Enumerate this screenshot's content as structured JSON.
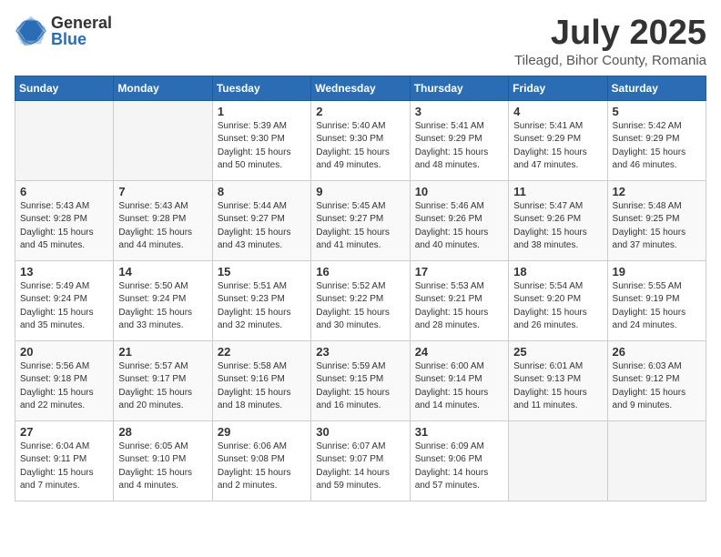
{
  "logo": {
    "general": "General",
    "blue": "Blue"
  },
  "title": "July 2025",
  "subtitle": "Tileagd, Bihor County, Romania",
  "days_header": [
    "Sunday",
    "Monday",
    "Tuesday",
    "Wednesday",
    "Thursday",
    "Friday",
    "Saturday"
  ],
  "weeks": [
    [
      {
        "num": "",
        "info": ""
      },
      {
        "num": "",
        "info": ""
      },
      {
        "num": "1",
        "info": "Sunrise: 5:39 AM\nSunset: 9:30 PM\nDaylight: 15 hours\nand 50 minutes."
      },
      {
        "num": "2",
        "info": "Sunrise: 5:40 AM\nSunset: 9:30 PM\nDaylight: 15 hours\nand 49 minutes."
      },
      {
        "num": "3",
        "info": "Sunrise: 5:41 AM\nSunset: 9:29 PM\nDaylight: 15 hours\nand 48 minutes."
      },
      {
        "num": "4",
        "info": "Sunrise: 5:41 AM\nSunset: 9:29 PM\nDaylight: 15 hours\nand 47 minutes."
      },
      {
        "num": "5",
        "info": "Sunrise: 5:42 AM\nSunset: 9:29 PM\nDaylight: 15 hours\nand 46 minutes."
      }
    ],
    [
      {
        "num": "6",
        "info": "Sunrise: 5:43 AM\nSunset: 9:28 PM\nDaylight: 15 hours\nand 45 minutes."
      },
      {
        "num": "7",
        "info": "Sunrise: 5:43 AM\nSunset: 9:28 PM\nDaylight: 15 hours\nand 44 minutes."
      },
      {
        "num": "8",
        "info": "Sunrise: 5:44 AM\nSunset: 9:27 PM\nDaylight: 15 hours\nand 43 minutes."
      },
      {
        "num": "9",
        "info": "Sunrise: 5:45 AM\nSunset: 9:27 PM\nDaylight: 15 hours\nand 41 minutes."
      },
      {
        "num": "10",
        "info": "Sunrise: 5:46 AM\nSunset: 9:26 PM\nDaylight: 15 hours\nand 40 minutes."
      },
      {
        "num": "11",
        "info": "Sunrise: 5:47 AM\nSunset: 9:26 PM\nDaylight: 15 hours\nand 38 minutes."
      },
      {
        "num": "12",
        "info": "Sunrise: 5:48 AM\nSunset: 9:25 PM\nDaylight: 15 hours\nand 37 minutes."
      }
    ],
    [
      {
        "num": "13",
        "info": "Sunrise: 5:49 AM\nSunset: 9:24 PM\nDaylight: 15 hours\nand 35 minutes."
      },
      {
        "num": "14",
        "info": "Sunrise: 5:50 AM\nSunset: 9:24 PM\nDaylight: 15 hours\nand 33 minutes."
      },
      {
        "num": "15",
        "info": "Sunrise: 5:51 AM\nSunset: 9:23 PM\nDaylight: 15 hours\nand 32 minutes."
      },
      {
        "num": "16",
        "info": "Sunrise: 5:52 AM\nSunset: 9:22 PM\nDaylight: 15 hours\nand 30 minutes."
      },
      {
        "num": "17",
        "info": "Sunrise: 5:53 AM\nSunset: 9:21 PM\nDaylight: 15 hours\nand 28 minutes."
      },
      {
        "num": "18",
        "info": "Sunrise: 5:54 AM\nSunset: 9:20 PM\nDaylight: 15 hours\nand 26 minutes."
      },
      {
        "num": "19",
        "info": "Sunrise: 5:55 AM\nSunset: 9:19 PM\nDaylight: 15 hours\nand 24 minutes."
      }
    ],
    [
      {
        "num": "20",
        "info": "Sunrise: 5:56 AM\nSunset: 9:18 PM\nDaylight: 15 hours\nand 22 minutes."
      },
      {
        "num": "21",
        "info": "Sunrise: 5:57 AM\nSunset: 9:17 PM\nDaylight: 15 hours\nand 20 minutes."
      },
      {
        "num": "22",
        "info": "Sunrise: 5:58 AM\nSunset: 9:16 PM\nDaylight: 15 hours\nand 18 minutes."
      },
      {
        "num": "23",
        "info": "Sunrise: 5:59 AM\nSunset: 9:15 PM\nDaylight: 15 hours\nand 16 minutes."
      },
      {
        "num": "24",
        "info": "Sunrise: 6:00 AM\nSunset: 9:14 PM\nDaylight: 15 hours\nand 14 minutes."
      },
      {
        "num": "25",
        "info": "Sunrise: 6:01 AM\nSunset: 9:13 PM\nDaylight: 15 hours\nand 11 minutes."
      },
      {
        "num": "26",
        "info": "Sunrise: 6:03 AM\nSunset: 9:12 PM\nDaylight: 15 hours\nand 9 minutes."
      }
    ],
    [
      {
        "num": "27",
        "info": "Sunrise: 6:04 AM\nSunset: 9:11 PM\nDaylight: 15 hours\nand 7 minutes."
      },
      {
        "num": "28",
        "info": "Sunrise: 6:05 AM\nSunset: 9:10 PM\nDaylight: 15 hours\nand 4 minutes."
      },
      {
        "num": "29",
        "info": "Sunrise: 6:06 AM\nSunset: 9:08 PM\nDaylight: 15 hours\nand 2 minutes."
      },
      {
        "num": "30",
        "info": "Sunrise: 6:07 AM\nSunset: 9:07 PM\nDaylight: 14 hours\nand 59 minutes."
      },
      {
        "num": "31",
        "info": "Sunrise: 6:09 AM\nSunset: 9:06 PM\nDaylight: 14 hours\nand 57 minutes."
      },
      {
        "num": "",
        "info": ""
      },
      {
        "num": "",
        "info": ""
      }
    ]
  ]
}
